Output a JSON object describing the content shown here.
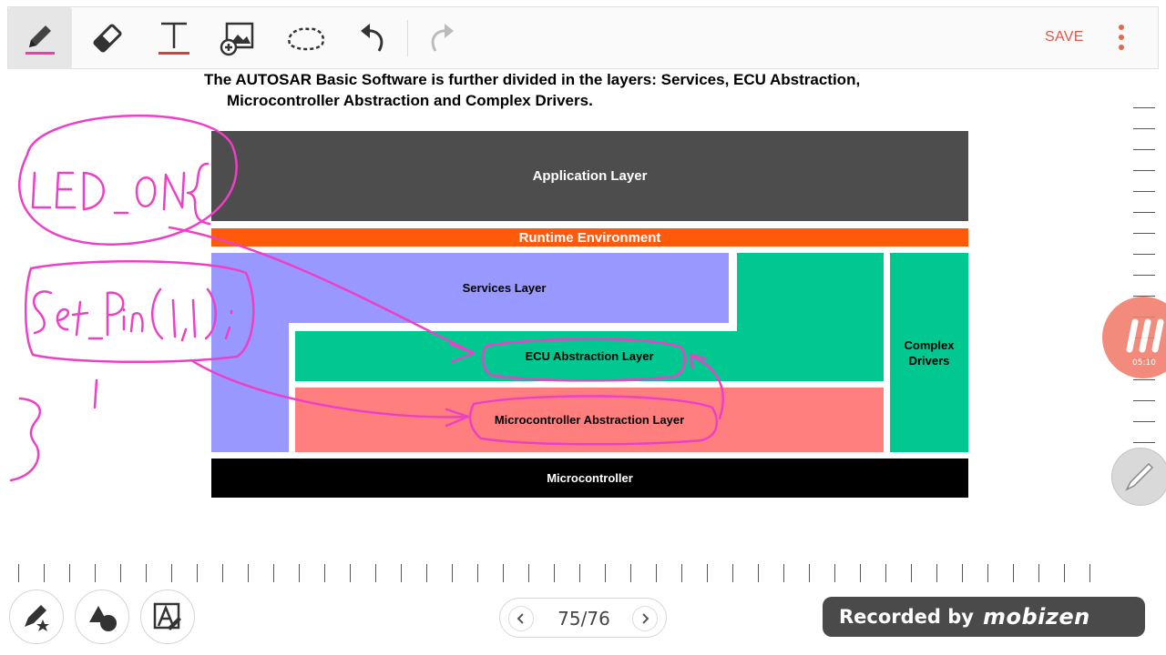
{
  "toolbar": {
    "tools": [
      {
        "name": "pen-tool",
        "icon": "pen-icon",
        "active": true
      },
      {
        "name": "eraser-tool",
        "icon": "eraser-icon"
      },
      {
        "name": "text-tool",
        "icon": "text-icon",
        "glyph": "T"
      },
      {
        "name": "insert-image-tool",
        "icon": "image-add-icon"
      },
      {
        "name": "lasso-tool",
        "icon": "lasso-icon"
      },
      {
        "name": "undo-tool",
        "icon": "undo-icon"
      },
      {
        "name": "redo-tool",
        "icon": "redo-icon",
        "disabled": true
      }
    ],
    "save_label": "SAVE",
    "accent_color": "#e0584a"
  },
  "slide": {
    "title_line1": "The AUTOSAR Basic Software is further divided in the layers: Services, ECU Abstraction,",
    "title_line2": "Microcontroller Abstraction and Complex Drivers.",
    "blocks": {
      "application": "Application Layer",
      "rte": "Runtime Environment",
      "services": "Services Layer",
      "ecu_abstraction": "ECU Abstraction Layer",
      "mcal": "Microcontroller Abstraction Layer",
      "complex_drivers_line1": "Complex",
      "complex_drivers_line2": "Drivers",
      "microcontroller": "Microcontroller"
    },
    "colors": {
      "application": "#4d4d4d",
      "rte": "#ff5a09",
      "services": "#9898ff",
      "ecu": "#00c890",
      "mcal": "#ff7f7f",
      "microcontroller": "#000000"
    }
  },
  "handwriting": {
    "ink_color": "#ee3fc7",
    "note1": "LED_ON{",
    "note2": "Set_Pin(1,1);"
  },
  "recording": {
    "time": "05:10",
    "badge_text": "Recorded by",
    "brand": "mobizen"
  },
  "bottom_tools": [
    {
      "name": "pen-settings-button",
      "icon": "pen-star-icon"
    },
    {
      "name": "shape-button",
      "icon": "shapes-icon"
    },
    {
      "name": "text-recognition-button",
      "icon": "handwriting-to-text-icon"
    }
  ],
  "pager": {
    "prev_icon": "chevron-left-icon",
    "next_icon": "chevron-right-icon",
    "page_label": "75/76"
  }
}
